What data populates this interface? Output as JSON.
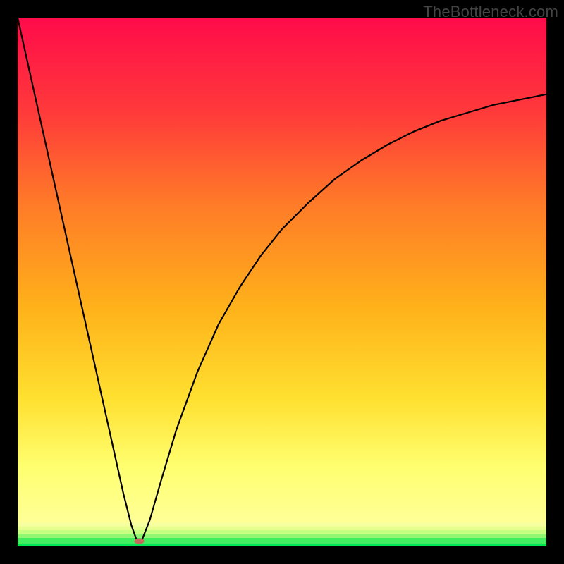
{
  "watermark": "TheBottleneck.com",
  "chart_data": {
    "type": "line",
    "title": "",
    "xlabel": "",
    "ylabel": "",
    "xlim": [
      0,
      100
    ],
    "ylim": [
      0,
      100
    ],
    "grid": false,
    "legend": false,
    "background_gradient": {
      "top_color": "#ff0b4a",
      "mid_colors": [
        "#ff6a2a",
        "#ffb21a",
        "#ffe020",
        "#ffff60"
      ],
      "bottom_color": "#00e756"
    },
    "series": [
      {
        "name": "bottleneck-curve",
        "color": "#000000",
        "x": [
          0,
          2,
          4,
          6,
          8,
          10,
          12,
          14,
          16,
          18,
          20,
          21.5,
          22.5,
          23.5,
          25,
          27,
          30,
          34,
          38,
          42,
          46,
          50,
          55,
          60,
          65,
          70,
          75,
          80,
          85,
          90,
          95,
          100
        ],
        "y": [
          100,
          91,
          82,
          73,
          64,
          55,
          46,
          37,
          28,
          19,
          10,
          4,
          1.2,
          1.2,
          5,
          12,
          22,
          33,
          42,
          49,
          55,
          60,
          65,
          69.5,
          73,
          76,
          78.5,
          80.5,
          82,
          83.5,
          84.5,
          85.5
        ]
      }
    ],
    "marker": {
      "name": "current-point",
      "x": 23,
      "y": 1,
      "color": "#c26a5b",
      "rx": 7,
      "ry": 4
    },
    "bottom_bands": [
      {
        "y": 4.5,
        "color": "#f8ffa0"
      },
      {
        "y": 3.8,
        "color": "#e8ff90"
      },
      {
        "y": 3.1,
        "color": "#c8ff80"
      },
      {
        "y": 2.4,
        "color": "#90f870"
      },
      {
        "y": 1.6,
        "color": "#40ee60"
      },
      {
        "y": 0.0,
        "color": "#00e756"
      }
    ]
  }
}
